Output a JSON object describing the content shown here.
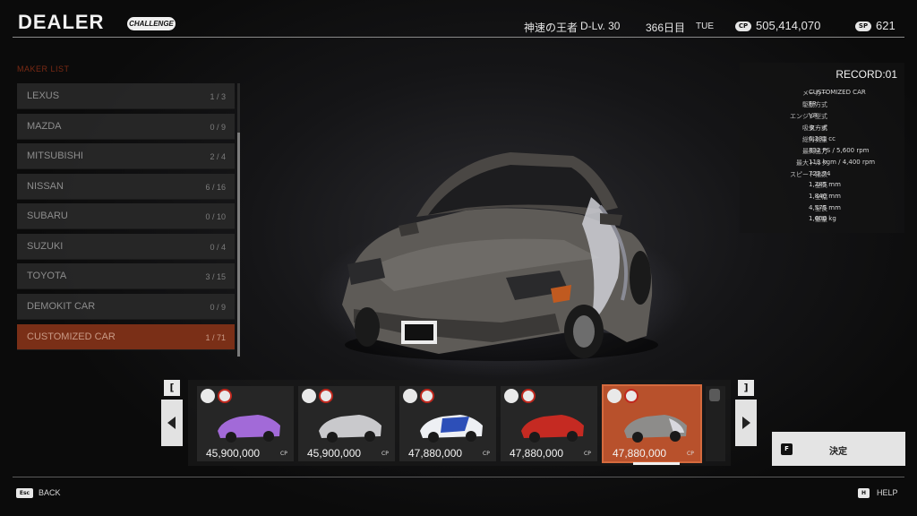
{
  "header": {
    "title": "DEALER",
    "mode_badge": "CHALLENGE",
    "player_title": "神速の王者",
    "driver_level": "D-Lv. 30",
    "day": "366日目",
    "weekday": "TUE",
    "cp_label": "CP",
    "cp_value": "505,414,070",
    "sp_label": "SP",
    "sp_value": "621"
  },
  "maker_list": {
    "title": "MAKER LIST",
    "items": [
      {
        "name": "LEXUS",
        "count": "1 / 3",
        "selected": false
      },
      {
        "name": "MAZDA",
        "count": "0 / 9",
        "selected": false
      },
      {
        "name": "MITSUBISHI",
        "count": "2 / 4",
        "selected": false
      },
      {
        "name": "NISSAN",
        "count": "6 / 16",
        "selected": false
      },
      {
        "name": "SUBARU",
        "count": "0 / 10",
        "selected": false
      },
      {
        "name": "SUZUKI",
        "count": "0 / 4",
        "selected": false
      },
      {
        "name": "TOYOTA",
        "count": "3 / 15",
        "selected": false
      },
      {
        "name": "DEMOKIT CAR",
        "count": "0 / 9",
        "selected": false
      },
      {
        "name": "CUSTOMIZED CAR",
        "count": "1 / 71",
        "selected": true
      }
    ]
  },
  "record": {
    "title": "RECORD:01",
    "specs": [
      {
        "label": "メーカー",
        "value": "CUSTOMIZED CAR"
      },
      {
        "label": "駆動方式",
        "value": "FR"
      },
      {
        "label": "エンジン型式",
        "value": "V8"
      },
      {
        "label": "吸気方式",
        "value": "ターボ"
      },
      {
        "label": "総排気量",
        "value": "6,231 cc"
      },
      {
        "label": "最高出力",
        "value": "832 PS / 5,600 rpm"
      },
      {
        "label": "最大トルク",
        "value": "113 kgm / 4,400 rpm"
      },
      {
        "label": "スピード指数",
        "value": "722.74"
      },
      {
        "label": "全高",
        "value": "1,285 mm"
      },
      {
        "label": "全幅",
        "value": "1,840 mm"
      },
      {
        "label": "全長",
        "value": "4,575 mm"
      },
      {
        "label": "重量",
        "value": "1,600 kg"
      }
    ]
  },
  "carousel": {
    "bracket_left": "[",
    "bracket_right": "]",
    "unit": "CP",
    "cards": [
      {
        "price": "45,900,000",
        "body_color": "#a26ad8",
        "selected": false
      },
      {
        "price": "45,900,000",
        "body_color": "#c9c9cc",
        "selected": false
      },
      {
        "price": "47,880,000",
        "body_color": "#eef0f4",
        "selected": false
      },
      {
        "price": "47,880,000",
        "body_color": "#c52a22",
        "selected": false
      },
      {
        "price": "47,880,000",
        "body_color": "#8d8c8a",
        "selected": true
      }
    ]
  },
  "confirm": {
    "key": "F",
    "label": "決定"
  },
  "footer": {
    "back_key": "Esc",
    "back_label": "BACK",
    "help_key": "H",
    "help_label": "HELP"
  },
  "colors": {
    "accent": "#b8512c",
    "selected_maker": "#7a2f17",
    "car_body": "#5e5b57"
  }
}
